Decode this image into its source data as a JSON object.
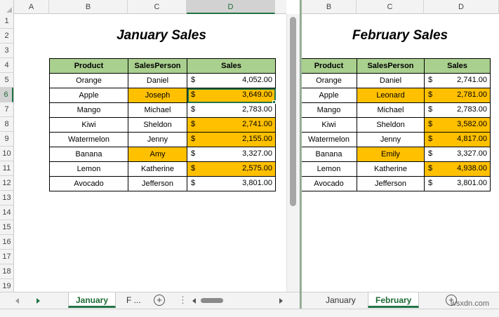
{
  "left": {
    "columns": [
      "A",
      "B",
      "C",
      "D"
    ],
    "selected_column": "D",
    "rows": [
      "1",
      "2",
      "3",
      "4",
      "5",
      "6",
      "7",
      "8",
      "9",
      "10",
      "11",
      "12",
      "13",
      "14",
      "15",
      "16",
      "17",
      "18",
      "19"
    ],
    "selected_row": "6",
    "title": "January Sales",
    "headers": [
      "Product",
      "SalesPerson",
      "Sales"
    ],
    "currency": "$",
    "data": [
      {
        "product": "Orange",
        "person": "Daniel",
        "sales": "4,052.00",
        "hl_person": false,
        "hl_sales": false
      },
      {
        "product": "Apple",
        "person": "Joseph",
        "sales": "3,649.00",
        "hl_person": true,
        "hl_sales": true
      },
      {
        "product": "Mango",
        "person": "Michael",
        "sales": "2,783.00",
        "hl_person": false,
        "hl_sales": false
      },
      {
        "product": "Kiwi",
        "person": "Sheldon",
        "sales": "2,741.00",
        "hl_person": false,
        "hl_sales": true
      },
      {
        "product": "Watermelon",
        "person": "Jenny",
        "sales": "2,155.00",
        "hl_person": false,
        "hl_sales": true
      },
      {
        "product": "Banana",
        "person": "Amy",
        "sales": "3,327.00",
        "hl_person": true,
        "hl_sales": false
      },
      {
        "product": "Lemon",
        "person": "Katherine",
        "sales": "2,575.00",
        "hl_person": false,
        "hl_sales": true
      },
      {
        "product": "Avocado",
        "person": "Jefferson",
        "sales": "3,801.00",
        "hl_person": false,
        "hl_sales": false
      }
    ],
    "tabs": {
      "active": "January",
      "next": "F ..."
    }
  },
  "right": {
    "columns": [
      "B",
      "C",
      "D"
    ],
    "title": "February Sales",
    "headers": [
      "Product",
      "SalesPerson",
      "Sales"
    ],
    "currency": "$",
    "data": [
      {
        "product": "Orange",
        "person": "Daniel",
        "sales": "2,741.00",
        "hl_person": false,
        "hl_sales": false
      },
      {
        "product": "Apple",
        "person": "Leonard",
        "sales": "2,781.00",
        "hl_person": true,
        "hl_sales": true
      },
      {
        "product": "Mango",
        "person": "Michael",
        "sales": "2,783.00",
        "hl_person": false,
        "hl_sales": false
      },
      {
        "product": "Kiwi",
        "person": "Sheldon",
        "sales": "3,582.00",
        "hl_person": false,
        "hl_sales": true
      },
      {
        "product": "Watermelon",
        "person": "Jenny",
        "sales": "4,817.00",
        "hl_person": false,
        "hl_sales": true
      },
      {
        "product": "Banana",
        "person": "Emily",
        "sales": "3,327.00",
        "hl_person": true,
        "hl_sales": false
      },
      {
        "product": "Lemon",
        "person": "Katherine",
        "sales": "4,938.00",
        "hl_person": false,
        "hl_sales": true
      },
      {
        "product": "Avocado",
        "person": "Jefferson",
        "sales": "3,801.00",
        "hl_person": false,
        "hl_sales": false
      }
    ],
    "tabs": {
      "first": "January",
      "active": "February"
    }
  },
  "colors": {
    "header_fill": "#a9d08e",
    "highlight": "#ffc000",
    "excel_green": "#217346"
  },
  "watermark": "wsxdn.com"
}
